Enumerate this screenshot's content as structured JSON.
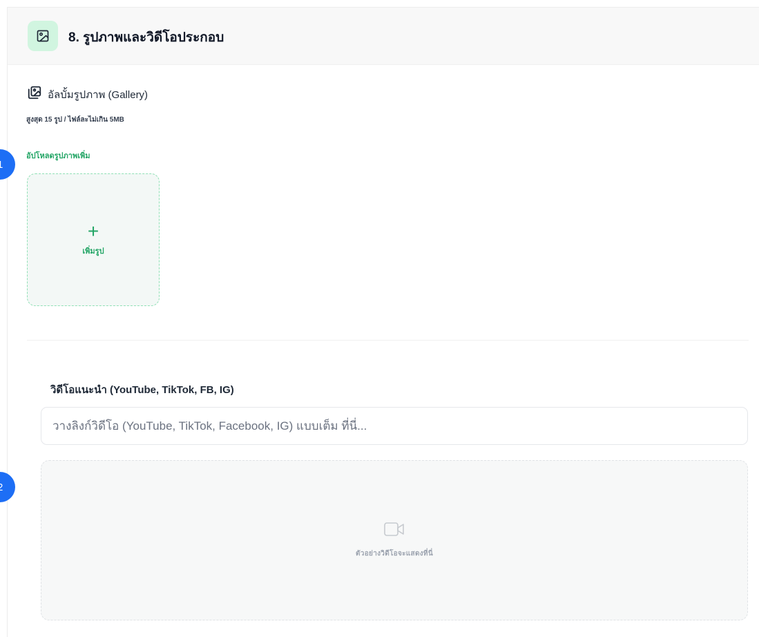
{
  "section": {
    "icon": "image-icon",
    "title": "8. รูปภาพและวิดีโอประกอบ"
  },
  "gallery": {
    "icon": "gallery-icon",
    "title": "อัลบั้มรูปภาพ (Gallery)",
    "hint": "สูงสุด 15 รูป / ไฟล์ละไม่เกิน 5MB",
    "upload_more": "อัปโหลดรูปภาพเพิ่ม",
    "add_label": "เพิ่มรูป",
    "add_icon": "plus-icon"
  },
  "video": {
    "label": "วิดีโอแนะนำ (YouTube, TikTok, FB, IG)",
    "placeholder": "วางลิงก์วิดีโอ (YouTube, TikTok, Facebook, IG) แบบเต็ม ที่นี่...",
    "value": "",
    "preview_icon": "video-camera-icon",
    "preview_text": "ตัวอย่างวิดีโอจะแสดงที่นี่"
  },
  "badges": [
    "1",
    "2"
  ],
  "colors": {
    "accent": "#22a565",
    "accent_light": "#d1f5e0",
    "badge": "#1d6ef5"
  }
}
